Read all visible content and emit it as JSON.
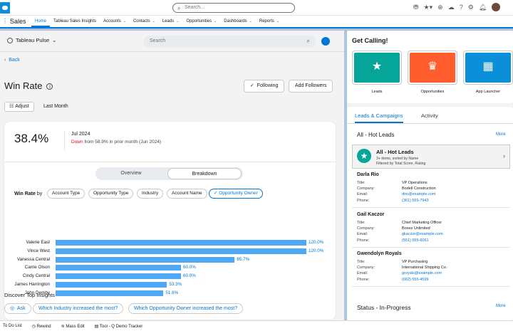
{
  "header": {
    "search_placeholder": "Search..."
  },
  "nav": {
    "app_name": "Sales",
    "items": [
      {
        "label": "Home",
        "chevron": false,
        "active": true
      },
      {
        "label": "Tableau Sales Insights",
        "chevron": false
      },
      {
        "label": "Accounts",
        "chevron": true
      },
      {
        "label": "Contacts",
        "chevron": true
      },
      {
        "label": "Leads",
        "chevron": true
      },
      {
        "label": "Opportunities",
        "chevron": true
      },
      {
        "label": "Dashboards",
        "chevron": true
      },
      {
        "label": "Reports",
        "chevron": true
      }
    ]
  },
  "subheader": {
    "app_label": "Tableau Pulse",
    "search_placeholder": "Search"
  },
  "page": {
    "back_label": "Back",
    "title": "Win Rate",
    "following_label": "Following",
    "add_followers_label": "Add Followers",
    "adjust_label": "Adjust",
    "period_label": "Last Month"
  },
  "metric": {
    "value": "38.4%",
    "period": "Jul 2024",
    "change_word": "Down",
    "change_text": "from 58.9% in prior month (Jun 2024)"
  },
  "view_toggle": {
    "overview": "Overview",
    "breakdown": "Breakdown"
  },
  "breakdown": {
    "by_label": "Win Rate",
    "by_suffix": "by",
    "dimensions": [
      "Account Type",
      "Opportunity Type",
      "Industry",
      "Account Name",
      "Opportunity Owner"
    ],
    "selected": "Opportunity Owner"
  },
  "chart_data": {
    "type": "bar",
    "orientation": "horizontal",
    "categories": [
      "Valerie East",
      "Vince West",
      "Vanessa Central",
      "Carrie Olson",
      "Cindy Central",
      "James Harrington",
      "John Demby"
    ],
    "values": [
      120.0,
      120.0,
      85.7,
      60.0,
      60.0,
      53.3,
      51.6
    ],
    "labels": [
      "120.0%",
      "120.0%",
      "85.7%",
      "60.0%",
      "60.0%",
      "53.3%",
      "51.6%"
    ],
    "color": "#4ea8f5",
    "max": 120
  },
  "insights": {
    "title": "Discover Top Insights",
    "ask_label": "Ask",
    "questions": [
      "Which Industry increased the most?",
      "Which Opportunity Owner increased the most?"
    ]
  },
  "get_calling": {
    "title": "Get Calling!",
    "tiles": [
      {
        "label": "Leads",
        "color": "#06a59a",
        "icon": "star-person-icon"
      },
      {
        "label": "Opportunities",
        "color": "#ff5d2d",
        "icon": "crown-icon"
      },
      {
        "label": "App Launcher",
        "color": "#0b8fd9",
        "icon": "grid-icon"
      }
    ]
  },
  "campaigns": {
    "tab_active": "Leads & Campaigns",
    "tab_other": "Activity",
    "section_title": "All - Hot Leads",
    "more_label": "More",
    "list_title": "All - Hot Leads",
    "list_meta1": "3+ items, sorted by Name",
    "list_meta2": "Filtered by Total Score, Rating",
    "leads": [
      {
        "name": "Darla Rio",
        "title": "VP Operations",
        "company": "Bodell Construction",
        "email": "drio@example.com",
        "phone": "(361) 555-7943"
      },
      {
        "name": "Gail Kaczor",
        "title": "Chief Marketing Officer",
        "company": "Boxes Unlimited",
        "email": "gkaczor@example.com",
        "phone": "(551) 555-6061"
      },
      {
        "name": "Gwendolyn Royals",
        "title": "VP Purchasing",
        "company": "International Shipping Co.",
        "email": "groyals@example.com",
        "phone": "(662) 555-4599"
      }
    ],
    "field_labels": {
      "title": "Title:",
      "company": "Company:",
      "email": "Email:",
      "phone": "Phone:"
    },
    "status_title": "Status - In-Progress",
    "status_more": "More"
  },
  "footer": {
    "items": [
      "To Do List",
      "Rewind",
      "Mass Edit",
      "Tool - Q Demo Tracker"
    ]
  }
}
